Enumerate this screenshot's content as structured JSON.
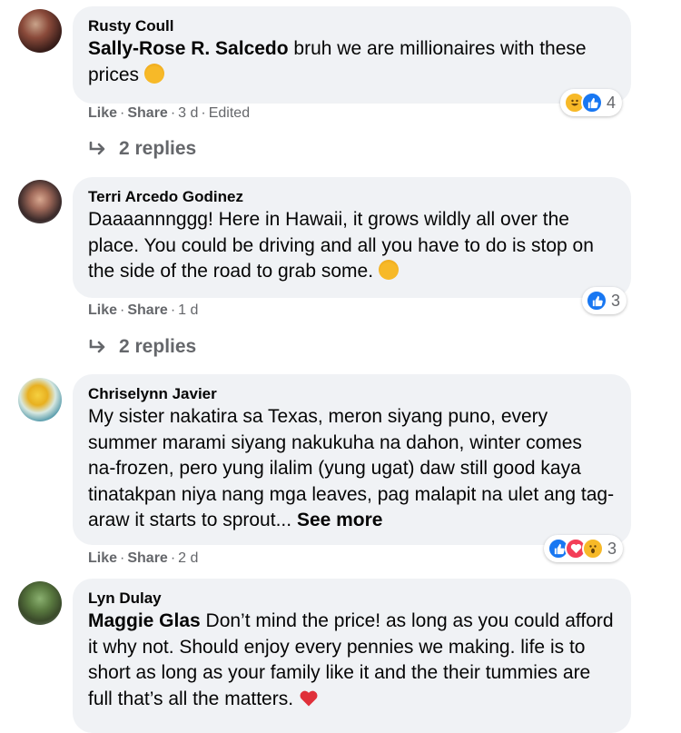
{
  "comments": [
    {
      "author": "Rusty Coull",
      "mention": "Sally-Rose R. Salcedo",
      "text": " bruh we are millionaires with these prices",
      "actions": {
        "like": "Like",
        "share": "Share",
        "time": "3 d",
        "edited": "Edited"
      },
      "reaction_count": "4",
      "reactions": [
        "haha-icon",
        "like-icon"
      ],
      "replies": "2 replies"
    },
    {
      "author": "Terri Arcedo Godinez",
      "text": "Daaaannnggg! Here in Hawaii, it grows wildly all over the place. You could be driving and all you have to do is stop on the side of the road to grab some.",
      "actions": {
        "like": "Like",
        "share": "Share",
        "time": "1 d"
      },
      "reaction_count": "3",
      "reactions": [
        "like-icon"
      ],
      "replies": "2 replies"
    },
    {
      "author": "Chriselynn Javier",
      "text": "My sister nakatira sa Texas, meron siyang puno, every summer marami siyang nakukuha na dahon, winter comes na-frozen, pero yung ilalim (yung ugat) daw still good kaya tinatakpan niya nang mga leaves, pag malapit na ulet ang tag-araw it starts to sprout...",
      "see_more": "See more",
      "actions": {
        "like": "Like",
        "share": "Share",
        "time": "2 d"
      },
      "reaction_count": "3",
      "reactions": [
        "like-icon",
        "love-icon",
        "wow-icon"
      ]
    },
    {
      "author": "Lyn Dulay",
      "mention": "Maggie Glas",
      "text": " Don’t mind the price! as long as you could afford it why not. Should enjoy every pennies we making. life is to short as long as your family like it and the their tummies are full that’s all the matters."
    }
  ],
  "colors": {
    "bubble": "#f0f2f5",
    "meta": "#65676b",
    "like": "#1877f2",
    "love": "#f33e58",
    "haha": "#f7b928"
  }
}
